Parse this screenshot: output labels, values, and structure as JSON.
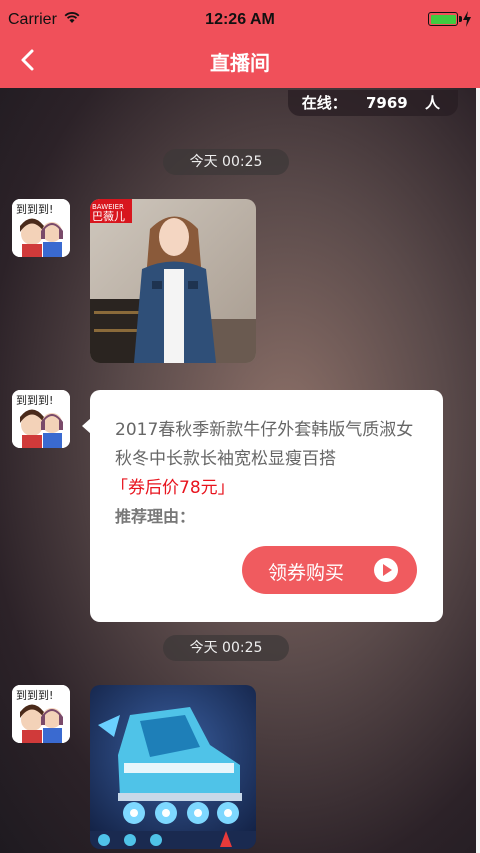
{
  "status_bar": {
    "carrier": "Carrier",
    "time": "12:26 AM"
  },
  "nav": {
    "back_icon": "chevron-left-icon",
    "title": "直播间"
  },
  "online": {
    "label": "在线：",
    "count": "7969",
    "unit": "人"
  },
  "messages": [
    {
      "type": "time",
      "text": "今天 00:25"
    },
    {
      "type": "image",
      "alt": "巴薇儿 denim jacket photo",
      "brand_text": "巴薇儿"
    },
    {
      "type": "product",
      "description": "2017春秋季新款牛仔外套韩版气质淑女秋冬中长款长袖宽松显瘦百搭",
      "price": "「券后价78元」",
      "reason": "推荐理由：",
      "button": "领券购买"
    },
    {
      "type": "time",
      "text": "今天 00:25"
    },
    {
      "type": "image",
      "alt": "inline skate photo"
    }
  ],
  "colors": {
    "accent": "#f0505a",
    "price": "#e8141e",
    "button": "#f05b5f"
  }
}
